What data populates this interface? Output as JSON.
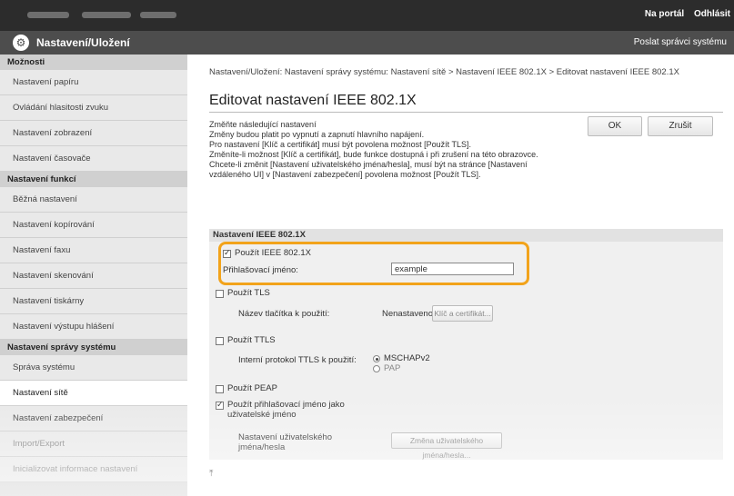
{
  "header": {
    "links": [
      "Na portál",
      "Odhlásit"
    ],
    "app_title": "Nastavení/Uložení",
    "admin_link": "Poslat správci systému"
  },
  "sidebar": {
    "sections": [
      {
        "title": "Možnosti",
        "items": [
          "Nastavení papíru",
          "Ovládání hlasitosti zvuku",
          "Nastavení zobrazení",
          "Nastavení časovače"
        ]
      },
      {
        "title": "Nastavení funkcí",
        "items": [
          "Běžná nastavení",
          "Nastavení kopírování",
          "Nastavení faxu",
          "Nastavení skenování",
          "Nastavení tiskárny",
          "Nastavení výstupu hlášení"
        ]
      },
      {
        "title": "Nastavení správy systému",
        "items": [
          "Správa systému",
          "Nastavení sítě",
          "Nastavení zabezpečení",
          "Import/Export",
          "Inicializovat informace nastavení"
        ]
      }
    ],
    "active_item": "Nastavení sítě"
  },
  "main": {
    "breadcrumb": "Nastavení/Uložení: Nastavení správy systému: Nastavení sítě > Nastavení IEEE 802.1X > Editovat nastavení IEEE 802.1X",
    "title": "Editovat nastavení IEEE 802.1X",
    "notice_lines": [
      "Změňte následující nastavení",
      "Změny budou platit po vypnutí a zapnutí hlavního napájení.",
      "Pro nastavení [Klíč a certifikát] musí být povolena možnost [Použít TLS].",
      "Změníte-li možnost [Klíč a certifikát], bude funkce dostupná i při zrušení na této obrazovce.",
      "Chcete-li změnit [Nastavení uživatelského jména/hesla], musí být na stránce [Nastavení vzdáleného UI] v [Nastavení zabezpečení] povolena možnost [Použít TLS]."
    ],
    "ok_label": "OK",
    "cancel_label": "Zrušit",
    "section_title": "Nastavení IEEE 802.1X",
    "use_ieee_label": "Použít IEEE 802.1X",
    "use_ieee_checked": true,
    "login_name_label": "Přihlašovací jméno:",
    "login_name_value": "example",
    "use_tls_label": "Použít TLS",
    "key_name_label": "Název tlačítka k použití:",
    "key_status": "Nenastaveno",
    "key_button_label": "Klíč a certifikát...",
    "use_ttls_label": "Použít TTLS",
    "ttls_protocol_label": "Interní protokol TTLS k použití:",
    "ttls_options": [
      "MSCHAPv2",
      "PAP"
    ],
    "ttls_selected": "MSCHAPv2",
    "use_peap_label": "Použít PEAP",
    "use_login_as_user_label": "Použít přihlašovací jméno jako uživatelské jméno",
    "use_login_as_user_checked": true,
    "user_pw_label": "Nastavení uživatelského jména/hesla",
    "user_pw_button_label": "Změna uživatelského jména/hesla...",
    "scroll_top_icon": "arrow-to-top-icon"
  },
  "colors": {
    "highlight": "#f2a31b",
    "topbar": "#2c2c2c",
    "titlebar": "#4d4d4d",
    "sidebar": "#d7d7d7"
  }
}
